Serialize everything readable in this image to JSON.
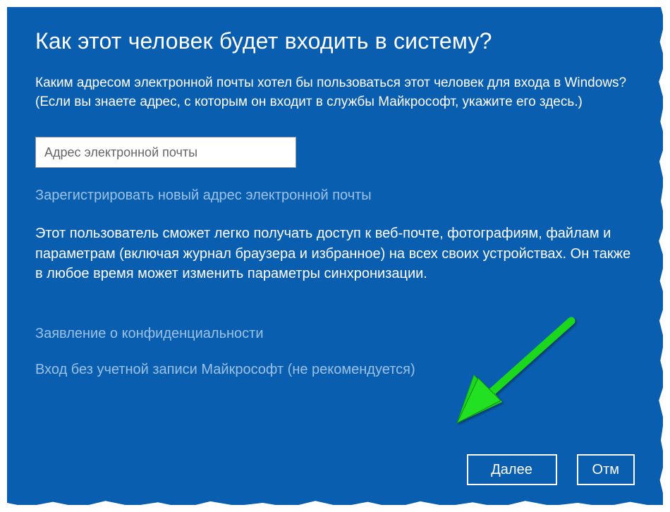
{
  "title": "Как этот человек будет входить в систему?",
  "description": "Каким адресом электронной почты хотел бы пользоваться этот человек для входа в Windows? (Если вы знаете адрес, с которым он входит в службы Майкрософт, укажите его здесь.)",
  "email": {
    "placeholder": "Адрес электронной почты",
    "value": ""
  },
  "links": {
    "register_new_email": "Зарегистрировать новый адрес электронной почты",
    "privacy_statement": "Заявление о конфиденциальности",
    "no_ms_account": "Вход без учетной записи Майкрософт (не рекомендуется)"
  },
  "body_text": "Этот пользователь сможет легко получать доступ к веб-почте, фотографиям, файлам и параметрам (включая журнал браузера и избранное) на всех своих устройствах. Он также в любое время может изменить параметры синхронизации.",
  "buttons": {
    "next": "Далее",
    "cancel": "Отм"
  },
  "annotation": {
    "arrow_color": "#1FD81F"
  }
}
